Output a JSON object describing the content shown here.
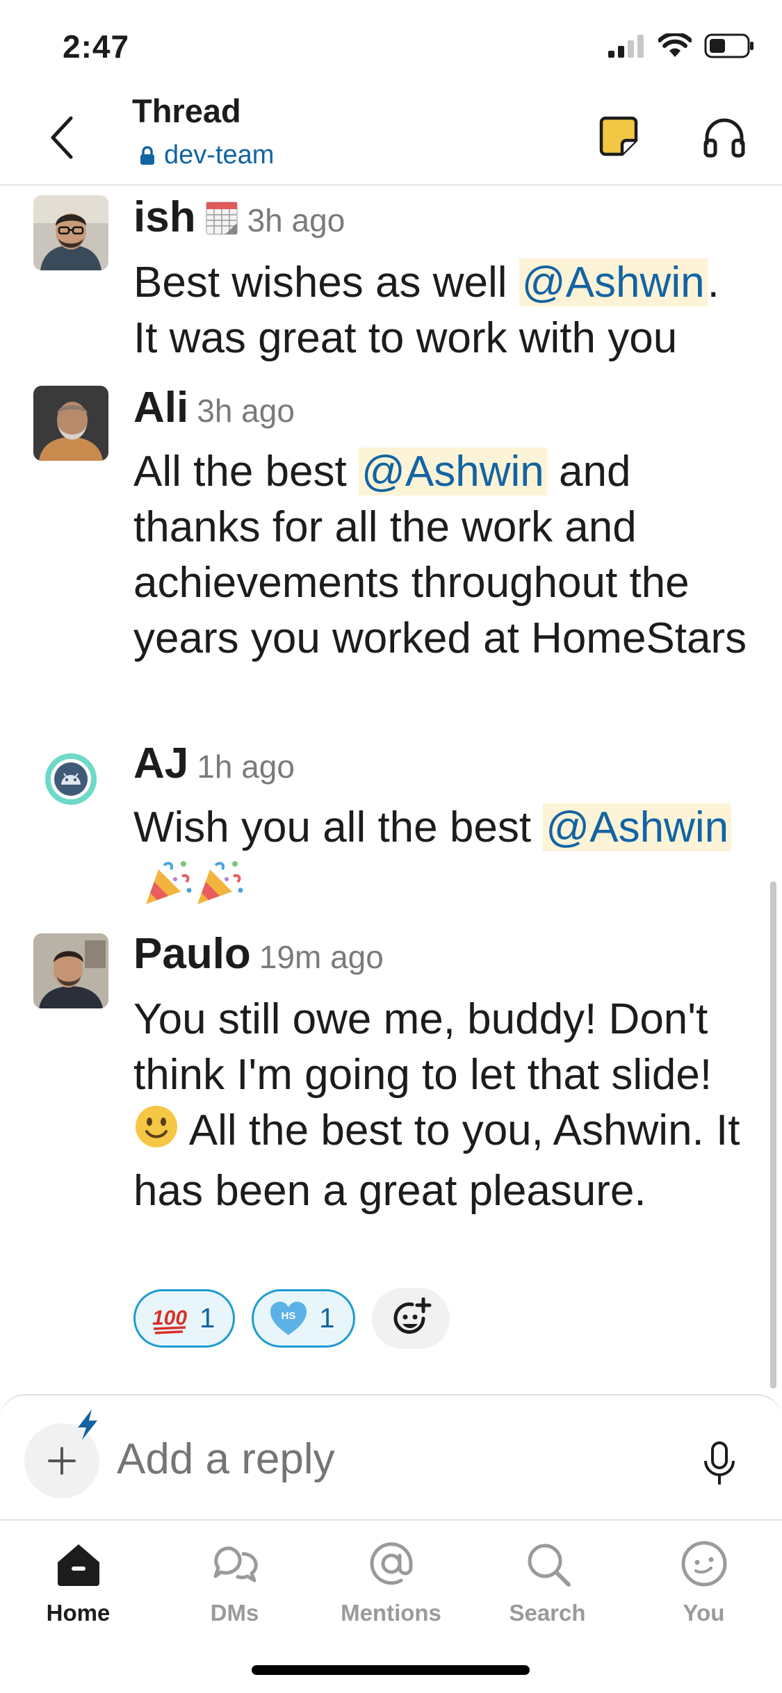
{
  "status_bar": {
    "time": "2:47"
  },
  "header": {
    "title": "Thread",
    "channel": "dev-team"
  },
  "messages": [
    {
      "author": "ish",
      "time": "3h ago",
      "text_before": "Best wishes as well ",
      "mention": "@Ashwin",
      "text_after": ". It was great to work with you"
    },
    {
      "author": "Ali",
      "time": "3h ago",
      "text_before": "All the best ",
      "mention": "@Ashwin",
      "text_after": " and thanks for all the work and achievements throughout the years you worked at HomeStars"
    },
    {
      "author": "AJ",
      "time": "1h ago",
      "text_before": "Wish you all the best ",
      "mention": "@Ashwin",
      "text_after": ""
    },
    {
      "author": "Paulo",
      "time": "19m ago",
      "text_before": "You still owe me, buddy! Don't think I'm going to let that slide! ",
      "text_after": " All the best to you, Ashwin. It has been a great pleasure."
    }
  ],
  "reactions": [
    {
      "emoji": "100-emoji",
      "count": "1"
    },
    {
      "emoji": "hs-heart-emoji",
      "badge": "HS",
      "count": "1"
    }
  ],
  "composer": {
    "placeholder": "Add a reply"
  },
  "tabs": [
    {
      "label": "Home",
      "icon": "home-icon",
      "active": true
    },
    {
      "label": "DMs",
      "icon": "dms-icon",
      "active": false
    },
    {
      "label": "Mentions",
      "icon": "mentions-icon",
      "active": false
    },
    {
      "label": "Search",
      "icon": "search-icon",
      "active": false
    },
    {
      "label": "You",
      "icon": "you-icon",
      "active": false
    }
  ],
  "colors": {
    "link": "#1264a3",
    "mention_bg": "#fdf3d7",
    "reaction_border": "#1d9bd1",
    "canvas_yellow": "#f2c744"
  }
}
